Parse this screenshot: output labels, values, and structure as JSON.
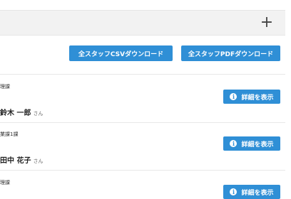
{
  "header": {
    "add_icon": "plus-icon",
    "add_glyph": "+"
  },
  "actions": {
    "csv_download_label": "全スタッフCSVダウンロード",
    "pdf_download_label": "全スタッフPDFダウンロード"
  },
  "staff": [
    {
      "department": "理課",
      "name": "鈴木 一郎",
      "suffix": "さん",
      "detail_label": "詳細を表示"
    },
    {
      "department": "業課1課",
      "name": "田中 花子",
      "suffix": "さん",
      "detail_label": "詳細を表示"
    },
    {
      "department": "理課",
      "name": "",
      "suffix": "",
      "detail_label": "詳細を表示"
    }
  ],
  "colors": {
    "accent": "#2f8fd6",
    "header_bg": "#f2f2f2"
  }
}
